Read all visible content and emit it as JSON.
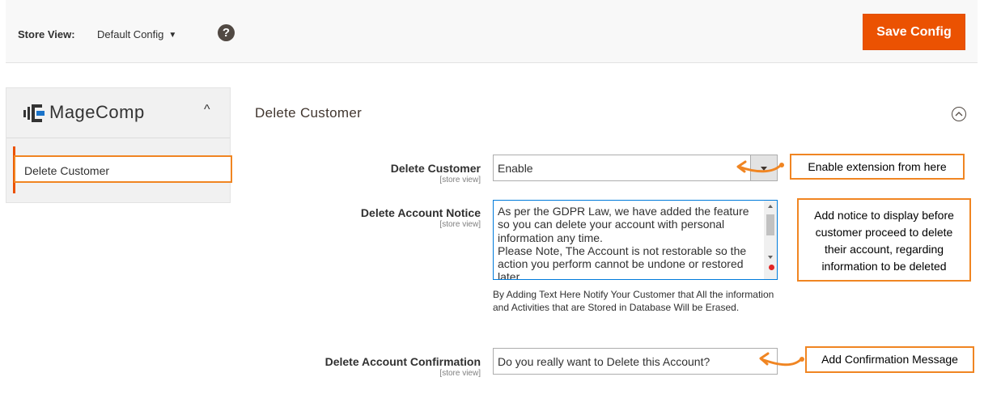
{
  "header": {
    "store_view_label": "Store View:",
    "store_view_value": "Default Config",
    "help_glyph": "?",
    "save_button": "Save Config"
  },
  "sidebar": {
    "brand": "MageComp",
    "toggle_glyph": "^",
    "items": [
      {
        "label": "Delete Customer"
      }
    ]
  },
  "section": {
    "title": "Delete Customer"
  },
  "fields": {
    "delete_customer": {
      "label": "Delete Customer",
      "scope": "[store view]",
      "value": "Enable"
    },
    "account_notice": {
      "label": "Delete Account Notice",
      "scope": "[store view]",
      "value": "As per the GDPR Law, we have added the feature so you can delete your account with personal information any time.\nPlease Note, The Account is not restorable so the action you perform cannot be undone or restored later.",
      "note": "By Adding Text Here Notify Your Customer that All the information and Activities that are Stored in Database Will be Erased."
    },
    "account_confirmation": {
      "label": "Delete Account Confirmation",
      "scope": "[store view]",
      "value": "Do you really want to Delete this Account?"
    }
  },
  "callouts": {
    "enable": "Enable extension from here",
    "notice": "Add notice to display before customer proceed to delete their account, regarding information to be deleted",
    "confirmation": "Add Confirmation Message"
  },
  "colors": {
    "accent": "#eb5202",
    "callout_border": "#f08522",
    "focus_border": "#007bdb"
  }
}
